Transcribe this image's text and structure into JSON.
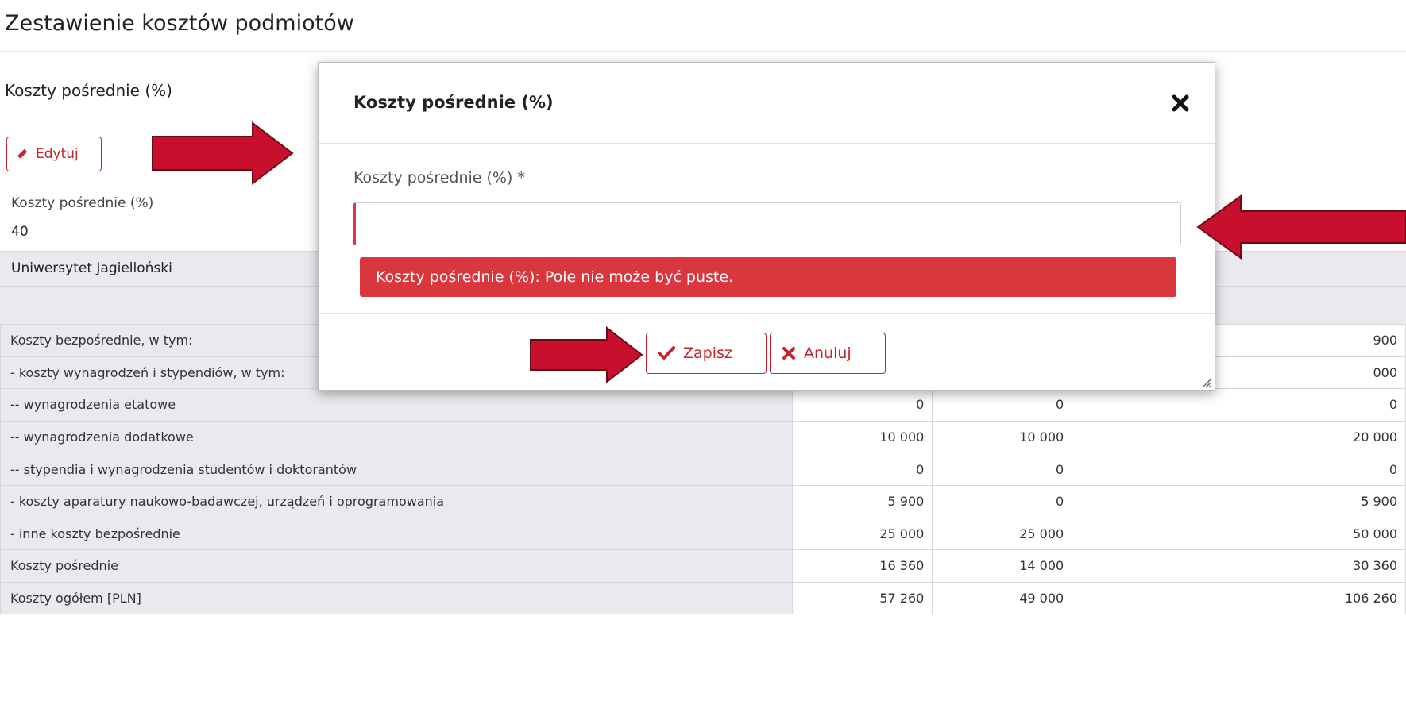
{
  "page": {
    "title": "Zestawienie kosztów podmiotów",
    "section_title": "Koszty pośrednie (%)",
    "edit_button": "Edytuj",
    "field_label": "Koszty pośrednie (%)",
    "field_value": "40",
    "organization": "Uniwersytet Jagielloński"
  },
  "table": {
    "rows": [
      {
        "label": "Koszty bezpośrednie, w tym:",
        "v1": "",
        "v2": "",
        "v3": "900"
      },
      {
        "label": "- koszty wynagrodzeń i stypendiów, w tym:",
        "v1": "",
        "v2": "",
        "v3": "000"
      },
      {
        "label": "-- wynagrodzenia etatowe",
        "v1": "0",
        "v2": "0",
        "v3": "0"
      },
      {
        "label": "-- wynagrodzenia dodatkowe",
        "v1": "10 000",
        "v2": "10 000",
        "v3": "20 000"
      },
      {
        "label": "-- stypendia i wynagrodzenia studentów i doktorantów",
        "v1": "0",
        "v2": "0",
        "v3": "0"
      },
      {
        "label": "- koszty aparatury naukowo-badawczej, urządzeń i oprogramowania",
        "v1": "5 900",
        "v2": "0",
        "v3": "5 900"
      },
      {
        "label": "- inne koszty bezpośrednie",
        "v1": "25 000",
        "v2": "25 000",
        "v3": "50 000"
      },
      {
        "label": "Koszty pośrednie",
        "v1": "16 360",
        "v2": "14 000",
        "v3": "30 360"
      },
      {
        "label": "Koszty ogółem [PLN]",
        "v1": "57 260",
        "v2": "49 000",
        "v3": "106 260"
      }
    ]
  },
  "modal": {
    "title": "Koszty pośrednie (%)",
    "field_label": "Koszty pośrednie (%) *",
    "input_value": "",
    "error_message": "Koszty pośrednie (%): Pole nie może być puste.",
    "save_label": "Zapisz",
    "cancel_label": "Anuluj"
  },
  "icons": {
    "edit": "pencil-icon",
    "close": "close-icon",
    "save": "check-icon",
    "cancel": "x-icon",
    "resize": "resize-handle-icon",
    "annotation": "arrow-annotation"
  },
  "colors": {
    "accent": "#c4262e",
    "error_bg": "#d9363e",
    "arrow": "#c8102e",
    "band": "#e9e9ee"
  }
}
